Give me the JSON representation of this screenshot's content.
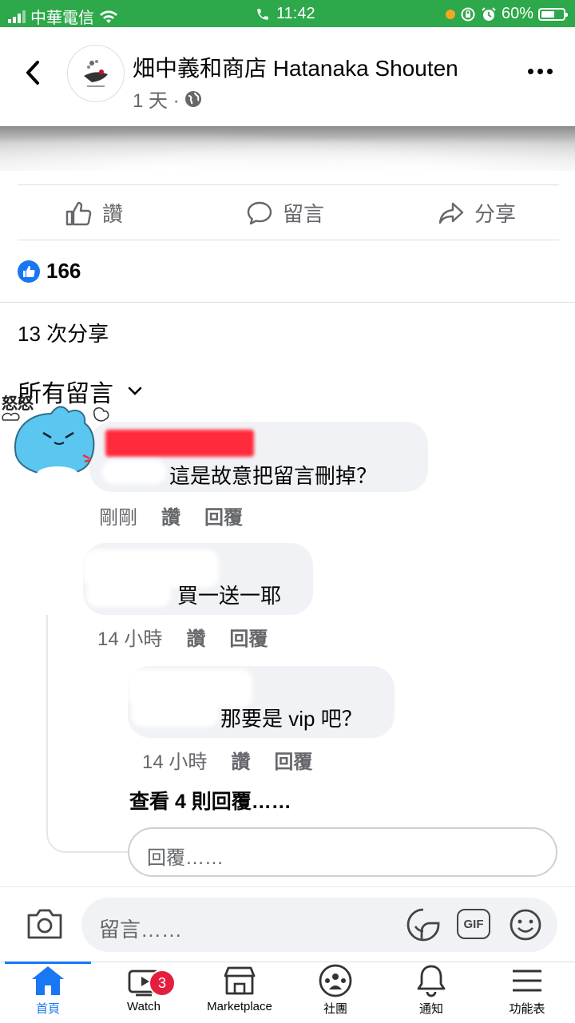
{
  "status_bar": {
    "carrier": "中華電信",
    "time": "11:42",
    "battery": "60%",
    "battery_level": 0.6
  },
  "header": {
    "page_name": "畑中義和商店 Hatanaka Shouten",
    "post_age": "1 天 ·"
  },
  "actions": {
    "like": "讚",
    "comment": "留言",
    "share": "分享"
  },
  "reactions": {
    "count": "166"
  },
  "shares": "13 次分享",
  "comments_filter": "所有留言",
  "sticker_text": "怒怒",
  "comments": [
    {
      "text": "這是故意把留言刪掉？",
      "time": "剛剛",
      "like": "讚",
      "reply": "回覆"
    },
    {
      "text": "買一送一耶",
      "time": "14 小時",
      "like": "讚",
      "reply": "回覆"
    },
    {
      "text": "那要是 vip 吧？",
      "time": "14 小時",
      "like": "讚",
      "reply": "回覆"
    }
  ],
  "view_more_replies": "查看 4 則回覆……",
  "reply_placeholder": "回覆……",
  "comment_placeholder": "留言……",
  "gif_label": "GIF",
  "tabs": [
    {
      "label": "首頁",
      "active": true
    },
    {
      "label": "Watch",
      "badge": "3"
    },
    {
      "label": "Marketplace"
    },
    {
      "label": "社團"
    },
    {
      "label": "通知"
    },
    {
      "label": "功能表"
    }
  ],
  "colors": {
    "status_bar": "#2da84a",
    "accent": "#1877f2",
    "badge": "#e41e3f",
    "bubble": "#f0f2f5"
  }
}
